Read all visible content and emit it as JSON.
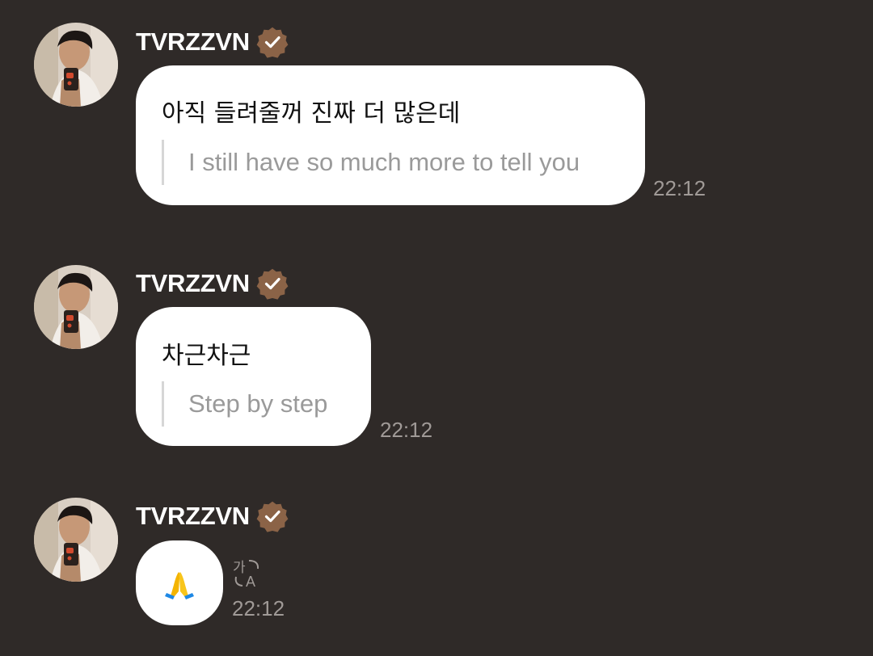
{
  "messages": [
    {
      "sender": "TVRZZVN",
      "text": "아직 들려줄꺼 진짜 더 많은데",
      "translation": "I still have so much more to tell you",
      "time": "22:12"
    },
    {
      "sender": "TVRZZVN",
      "text": "차근차근",
      "translation": "Step by step",
      "time": "22:12"
    },
    {
      "sender": "TVRZZVN",
      "emoji": "folded-hands-emoji",
      "translate_icon": "translate-icon",
      "time": "22:12"
    }
  ],
  "colors": {
    "background": "#2f2a28",
    "bubble": "#ffffff",
    "verified_badge": "#8b6347",
    "timestamp": "#a09a97",
    "translation_text": "#9a9a9a"
  },
  "icons": {
    "avatar": "profile-photo",
    "verified": "verified-badge-icon"
  }
}
